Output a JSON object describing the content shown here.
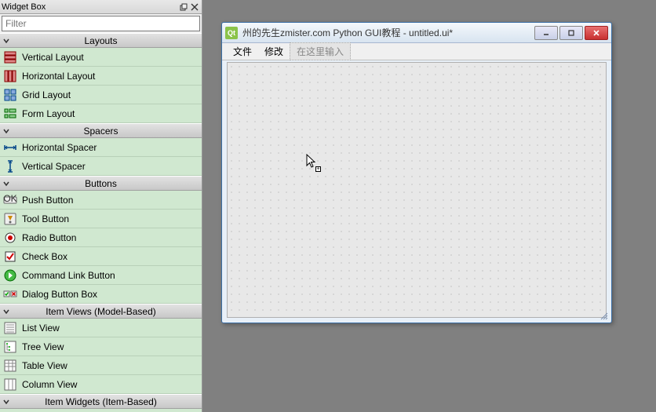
{
  "widgetbox": {
    "title": "Widget Box",
    "filter_placeholder": "Filter",
    "categories": [
      {
        "name": "Layouts",
        "items": [
          {
            "label": "Vertical Layout",
            "icon": "vlayout"
          },
          {
            "label": "Horizontal Layout",
            "icon": "hlayout"
          },
          {
            "label": "Grid Layout",
            "icon": "gridlayout"
          },
          {
            "label": "Form Layout",
            "icon": "formlayout"
          }
        ]
      },
      {
        "name": "Spacers",
        "items": [
          {
            "label": "Horizontal Spacer",
            "icon": "hspacer"
          },
          {
            "label": "Vertical Spacer",
            "icon": "vspacer"
          }
        ]
      },
      {
        "name": "Buttons",
        "items": [
          {
            "label": "Push Button",
            "icon": "pushbtn"
          },
          {
            "label": "Tool Button",
            "icon": "toolbtn"
          },
          {
            "label": "Radio Button",
            "icon": "radiobtn"
          },
          {
            "label": "Check Box",
            "icon": "checkbox"
          },
          {
            "label": "Command Link Button",
            "icon": "cmdlink"
          },
          {
            "label": "Dialog Button Box",
            "icon": "dlgbtnbox"
          }
        ]
      },
      {
        "name": "Item Views (Model-Based)",
        "items": [
          {
            "label": "List View",
            "icon": "listview"
          },
          {
            "label": "Tree View",
            "icon": "treeview"
          },
          {
            "label": "Table View",
            "icon": "tableview"
          },
          {
            "label": "Column View",
            "icon": "columnview"
          }
        ]
      },
      {
        "name": "Item Widgets (Item-Based)",
        "items": []
      }
    ]
  },
  "designer": {
    "app_icon_text": "Qt",
    "title": "州的先生zmister.com Python GUI教程 - untitled.ui*",
    "menus": [
      "文件",
      "修改"
    ],
    "menu_placeholder": "在这里输入"
  }
}
